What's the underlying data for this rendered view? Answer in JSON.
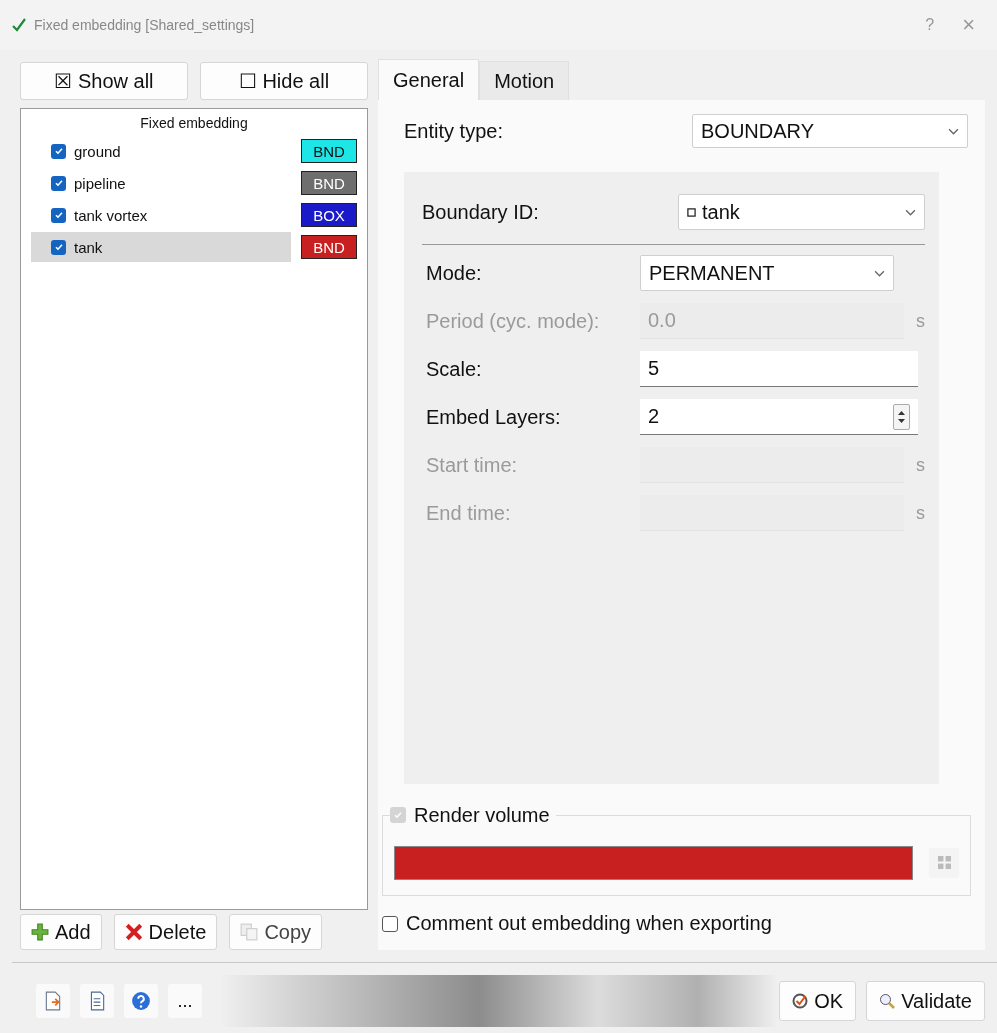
{
  "window": {
    "title": "Fixed embedding [Shared_settings]",
    "help": "?",
    "close": "×"
  },
  "list_buttons": [
    {
      "glyph": "☒",
      "label": "Show all"
    },
    {
      "glyph": "☐",
      "label": "Hide all"
    }
  ],
  "list": {
    "heading": "Fixed embedding",
    "items": [
      {
        "name": "ground",
        "checked": true,
        "selected": false,
        "tag": "BND",
        "color": "#1ee6e6"
      },
      {
        "name": "pipeline",
        "checked": true,
        "selected": false,
        "tag": "BND",
        "color": "#6e6e6e"
      },
      {
        "name": "tank vortex",
        "checked": true,
        "selected": false,
        "tag": "BOX",
        "color": "#1a1ac8"
      },
      {
        "name": "tank",
        "checked": true,
        "selected": true,
        "tag": "BND",
        "color": "#c82020"
      }
    ]
  },
  "list_actions": [
    {
      "kind": "add",
      "label": "Add",
      "disabled": false
    },
    {
      "kind": "delete",
      "label": "Delete",
      "disabled": false
    },
    {
      "kind": "copy",
      "label": "Copy",
      "disabled": true
    }
  ],
  "tabs": [
    {
      "label": "General",
      "selected": true
    },
    {
      "label": "Motion",
      "selected": false
    }
  ],
  "entity_type": {
    "label": "Entity type:",
    "value": "BOUNDARY"
  },
  "boundary_id": {
    "label": "Boundary ID:",
    "value": "tank"
  },
  "fields": [
    {
      "kind": "select",
      "label": "Mode:",
      "value": "PERMANENT",
      "disabled": false
    },
    {
      "kind": "input",
      "label": "Period (cyc. mode):",
      "value": "0.0",
      "unit": "s",
      "disabled": true
    },
    {
      "kind": "input",
      "label": "Scale:",
      "value": "5",
      "disabled": false
    },
    {
      "kind": "spin",
      "label": "Embed Layers:",
      "value": "2",
      "disabled": false
    },
    {
      "kind": "input",
      "label": "Start time:",
      "unit": "s",
      "disabled": true
    },
    {
      "kind": "input",
      "label": "End time:",
      "unit": "s",
      "disabled": true
    }
  ],
  "render_volume": {
    "label": "Render volume",
    "checked": true,
    "disabled": true,
    "color": "#c82020"
  },
  "comment_out": {
    "label": "Comment out embedding when exporting",
    "checked": false
  },
  "footer_tools": [
    {
      "kind": "export"
    },
    {
      "kind": "document"
    },
    {
      "kind": "help"
    },
    {
      "kind": "more",
      "label": "..."
    }
  ],
  "footer_buttons": [
    {
      "kind": "ok",
      "label": "OK"
    },
    {
      "kind": "validate",
      "label": "Validate"
    }
  ]
}
